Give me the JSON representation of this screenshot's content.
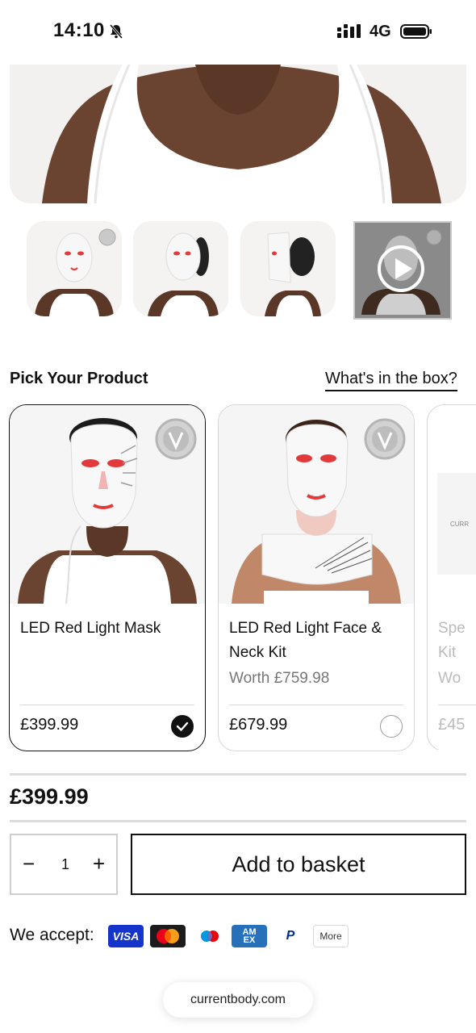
{
  "status_bar": {
    "time": "14:10",
    "network": "4G",
    "icons": [
      "bell-slash-icon",
      "signal-icon",
      "battery-icon"
    ]
  },
  "gallery": {
    "thumbnails": [
      {
        "label": "mask-front",
        "selected": false
      },
      {
        "label": "mask-three-quarter",
        "selected": false
      },
      {
        "label": "mask-side",
        "selected": false
      },
      {
        "label": "video",
        "selected": true
      }
    ]
  },
  "pick": {
    "title": "Pick Your Product",
    "whats_in_box": "What's in the box?"
  },
  "products": [
    {
      "name": "LED Red Light Mask",
      "worth": "",
      "price": "£399.99",
      "selected": true
    },
    {
      "name": "LED Red Light Face & Neck Kit",
      "worth": "Worth £759.98",
      "price": "£679.99",
      "selected": false
    },
    {
      "name": "Spe Kit",
      "name_line1": "Spe",
      "name_line2": "Kit",
      "worth": "Wo",
      "price": "£45",
      "selected": false
    }
  ],
  "total_price": "£399.99",
  "quantity": {
    "minus": "−",
    "value": "1",
    "plus": "+"
  },
  "add_to_basket": "Add to basket",
  "payments": {
    "label": "We accept:",
    "visa": "VISA",
    "amex_line1": "AM",
    "amex_line2": "EX",
    "paypal": "P",
    "more": "More"
  },
  "url": "currentbody.com",
  "colors": {
    "accent": "#111111",
    "visa": "#1434cb",
    "amex": "#2671b9",
    "led_red": "#e23a3a"
  }
}
